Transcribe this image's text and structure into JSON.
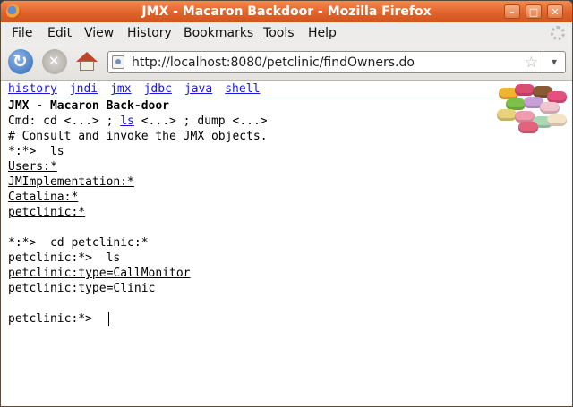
{
  "window": {
    "title": "JMX - Macaron Backdoor - Mozilla Firefox"
  },
  "menu": [
    {
      "label": "File",
      "u": "F",
      "rest": "ile"
    },
    {
      "label": "Edit",
      "u": "E",
      "rest": "dit"
    },
    {
      "label": "View",
      "u": "V",
      "rest": "iew"
    },
    {
      "label": "History",
      "u": "",
      "rest": "History"
    },
    {
      "label": "Bookmarks",
      "u": "B",
      "rest": "ookmarks"
    },
    {
      "label": "Tools",
      "u": "T",
      "rest": "ools"
    },
    {
      "label": "Help",
      "u": "H",
      "rest": "elp"
    }
  ],
  "address": {
    "url": "http://localhost:8080/petclinic/findOwners.do"
  },
  "nav_links": [
    "history",
    "jndi",
    "jmx",
    "jdbc",
    "java",
    "shell"
  ],
  "header": {
    "title": "JMX - Macaron Back-door",
    "cmd_prefix": "Cmd: cd <...> ; ",
    "cmd_link": "ls",
    "cmd_suffix": " <...> ; dump <...>",
    "comment": "# Consult and invoke the JMX objects."
  },
  "console": {
    "prompt1": "*:*>  ls",
    "entries1": [
      "Users:*",
      "JMImplementation:*",
      "Catalina:*",
      "petclinic:*"
    ],
    "prompt2": "*:*>  cd petclinic:*",
    "prompt3": "petclinic:*>  ls",
    "entries2": [
      "petclinic:type=CallMonitor",
      "petclinic:type=Clinic"
    ],
    "prompt4": "petclinic:*>"
  },
  "colors": {
    "titlebar": "#e0632a",
    "link": "#1a1ad6"
  }
}
